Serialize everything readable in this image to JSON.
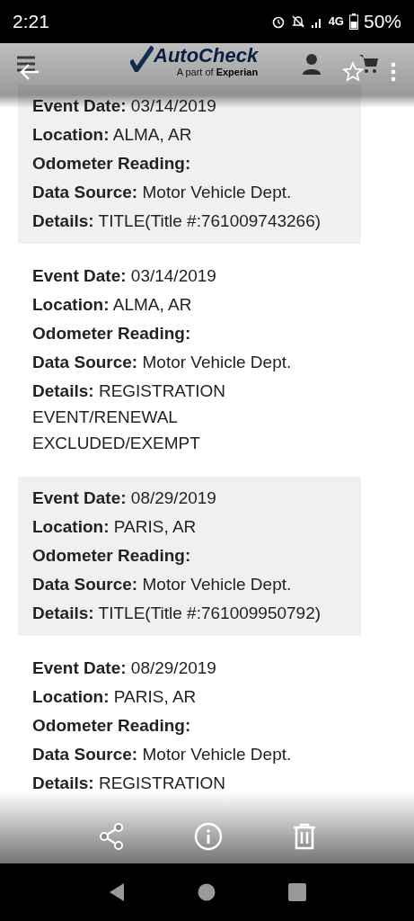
{
  "status_bar": {
    "time": "2:21",
    "network": "4G",
    "battery": "50%"
  },
  "site_header": {
    "logo_title": "AutoCheck",
    "logo_prefix": "A part of ",
    "logo_brand": "Experian"
  },
  "records": [
    {
      "shaded": true,
      "fields": [
        {
          "label": "Event Date:",
          "value": "03/14/2019"
        },
        {
          "label": "Location:",
          "value": "ALMA, AR"
        },
        {
          "label": "Odometer Reading:"
        },
        {
          "label": "Data Source:",
          "value": "Motor Vehicle Dept."
        },
        {
          "label": "Details:",
          "value": "TITLE(Title #:761009743266)"
        }
      ]
    },
    {
      "shaded": false,
      "fields": [
        {
          "label": "Event Date:",
          "value": "03/14/2019"
        },
        {
          "label": "Location:",
          "value": "ALMA, AR"
        },
        {
          "label": "Odometer Reading:"
        },
        {
          "label": "Data Source:",
          "value": "Motor Vehicle Dept."
        },
        {
          "label": "Details:",
          "value": "REGISTRATION EVENT/RENEWAL EXCLUDED/EXEMPT"
        }
      ]
    },
    {
      "shaded": true,
      "fields": [
        {
          "label": "Event Date:",
          "value": "08/29/2019"
        },
        {
          "label": "Location:",
          "value": "PARIS, AR"
        },
        {
          "label": "Odometer Reading:"
        },
        {
          "label": "Data Source:",
          "value": "Motor Vehicle Dept."
        },
        {
          "label": "Details:",
          "value": "TITLE(Title #:761009950792)"
        }
      ]
    },
    {
      "shaded": false,
      "fields": [
        {
          "label": "Event Date:",
          "value": "08/29/2019"
        },
        {
          "label": "Location:",
          "value": "PARIS, AR"
        },
        {
          "label": "Odometer Reading:"
        },
        {
          "label": "Data Source:",
          "value": "Motor Vehicle Dept."
        },
        {
          "label": "Details:",
          "value": "REGISTRATION"
        }
      ]
    }
  ]
}
